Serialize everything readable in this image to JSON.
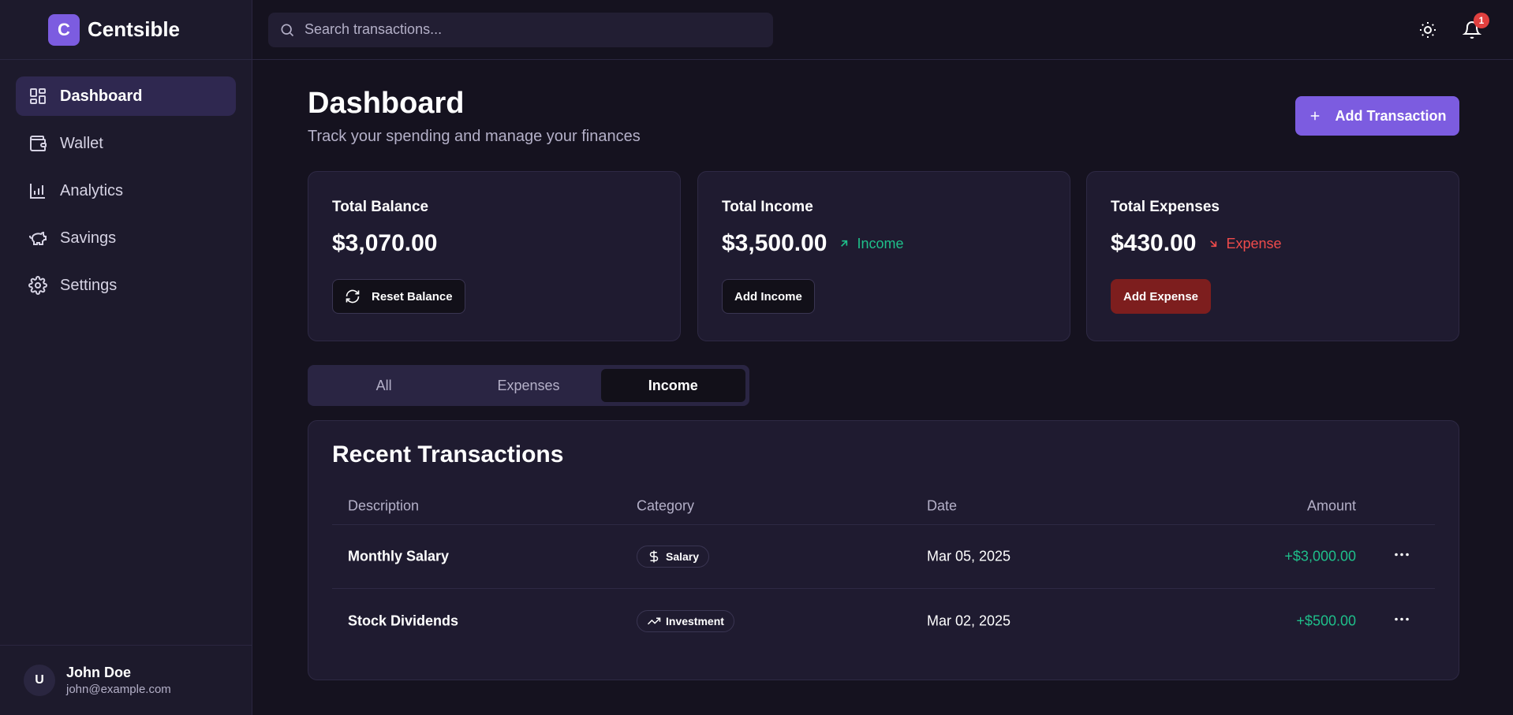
{
  "brand": {
    "logo_letter": "C",
    "name": "Centsible"
  },
  "sidebar": {
    "items": [
      {
        "label": "Dashboard",
        "icon": "dashboard-icon",
        "active": true
      },
      {
        "label": "Wallet",
        "icon": "wallet-icon"
      },
      {
        "label": "Analytics",
        "icon": "bar-chart-icon"
      },
      {
        "label": "Savings",
        "icon": "piggy-bank-icon"
      },
      {
        "label": "Settings",
        "icon": "gear-icon"
      }
    ],
    "user": {
      "initial": "U",
      "name": "John Doe",
      "email": "john@example.com"
    }
  },
  "topbar": {
    "search_placeholder": "Search transactions...",
    "notification_count": "1"
  },
  "header": {
    "title": "Dashboard",
    "subtitle": "Track your spending and manage your finances",
    "add_label": "Add Transaction"
  },
  "cards": {
    "balance": {
      "title": "Total Balance",
      "value": "$3,070.00",
      "button": "Reset Balance"
    },
    "income": {
      "title": "Total Income",
      "value": "$3,500.00",
      "trend": "Income",
      "button": "Add Income"
    },
    "expenses": {
      "title": "Total Expenses",
      "value": "$430.00",
      "trend": "Expense",
      "button": "Add Expense"
    }
  },
  "tabs": [
    {
      "label": "All"
    },
    {
      "label": "Expenses"
    },
    {
      "label": "Income",
      "active": true
    }
  ],
  "transactions": {
    "title": "Recent Transactions",
    "columns": [
      "Description",
      "Category",
      "Date",
      "Amount"
    ],
    "rows": [
      {
        "description": "Monthly Salary",
        "category": "Salary",
        "category_icon": "dollar-icon",
        "date": "Mar 05, 2025",
        "amount": "+$3,000.00"
      },
      {
        "description": "Stock Dividends",
        "category": "Investment",
        "category_icon": "trending-up-icon",
        "date": "Mar 02, 2025",
        "amount": "+$500.00"
      }
    ]
  },
  "colors": {
    "accent": "#7c5ce0",
    "income": "#1fbf8a",
    "expense": "#ef4b4b",
    "expense_button": "#7d1e1e"
  }
}
